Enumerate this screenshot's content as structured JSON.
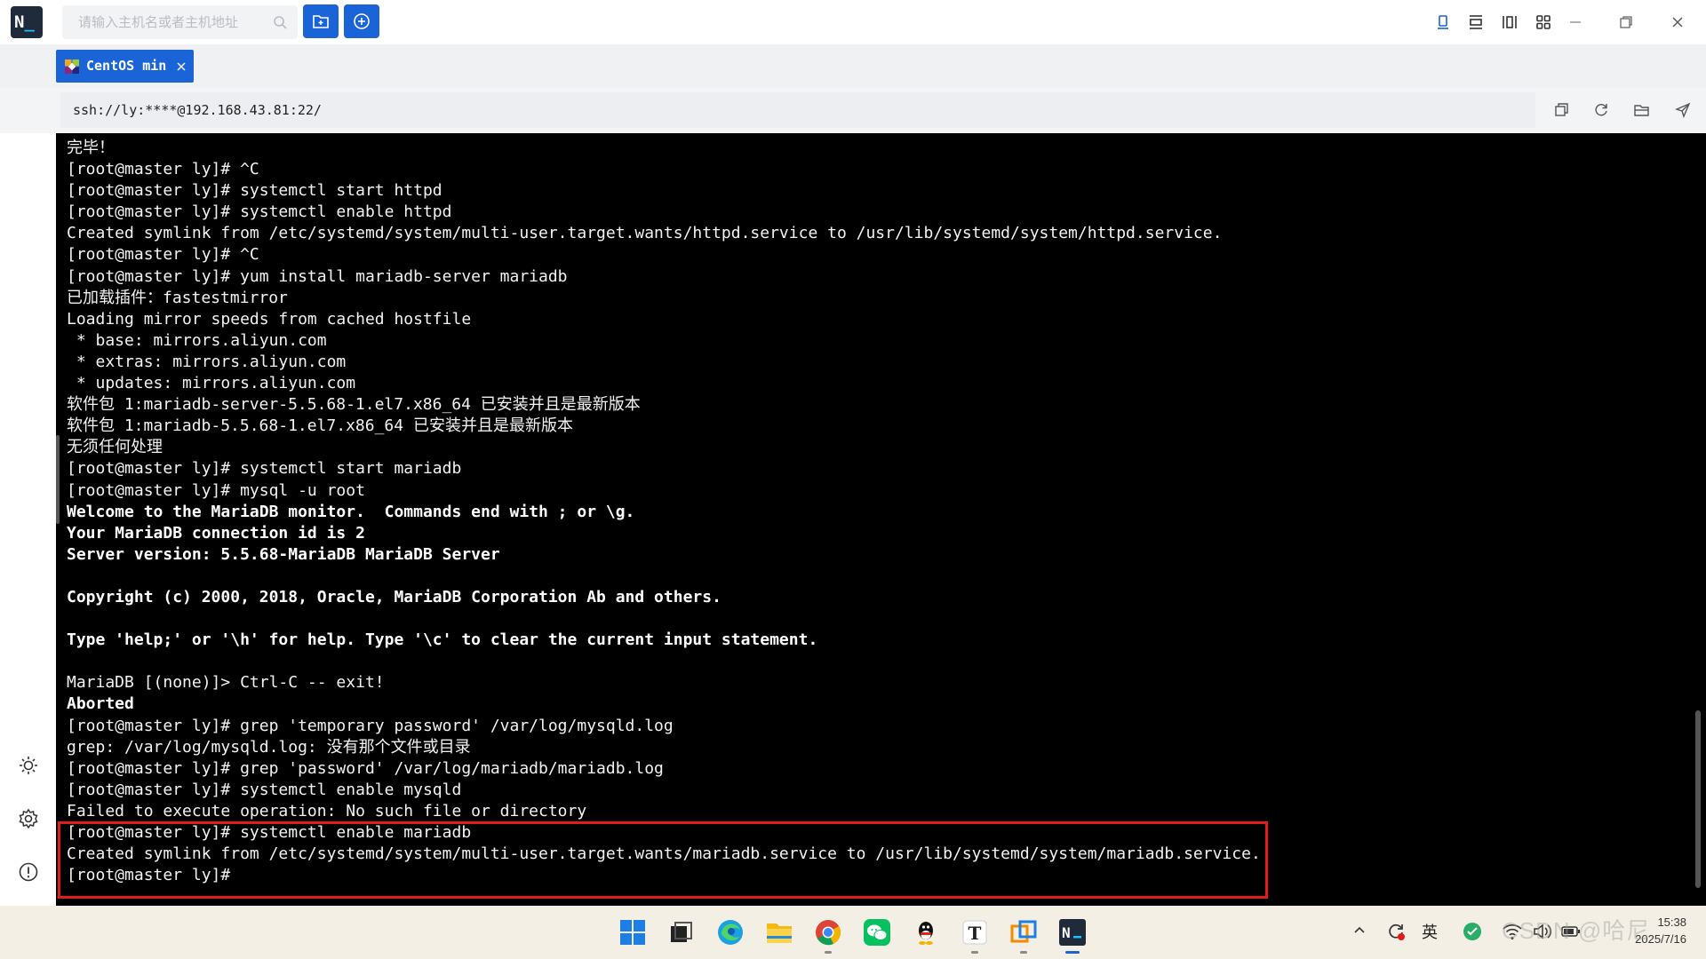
{
  "app": {
    "logo_n": "N",
    "logo_cursor": "_",
    "search_placeholder": "请输入主机名或者主机地址",
    "icons": {
      "search": "search-icon",
      "new_folder": "folder-add-icon",
      "new_connection": "plus-circle-icon",
      "view_single": "view-single-icon",
      "view_rows": "view-rows-icon",
      "view_columns": "view-columns-icon",
      "view_grid": "view-grid-icon",
      "minimize": "minimize-icon",
      "maximize": "restore-icon",
      "close": "close-icon"
    },
    "accent_color": "#1a64d8"
  },
  "tab": {
    "label": "CentOS min",
    "icon": "centos-icon",
    "close_icon": "close-icon"
  },
  "address": {
    "value": "ssh://ly:****@192.168.43.81:22/",
    "icons": [
      "copy-icon",
      "refresh-icon",
      "folder-open-icon",
      "send-icon"
    ]
  },
  "sidebar_icons": [
    "theme-sun-icon",
    "settings-gear-icon",
    "info-icon"
  ],
  "terminal": {
    "lines": [
      {
        "text": "完毕！",
        "bold": false
      },
      {
        "text": "[root@master ly]# ^C",
        "bold": false
      },
      {
        "text": "[root@master ly]# systemctl start httpd",
        "bold": false
      },
      {
        "text": "[root@master ly]# systemctl enable httpd",
        "bold": false
      },
      {
        "text": "Created symlink from /etc/systemd/system/multi-user.target.wants/httpd.service to /usr/lib/systemd/system/httpd.service.",
        "bold": false
      },
      {
        "text": "[root@master ly]# ^C",
        "bold": false
      },
      {
        "text": "[root@master ly]# yum install mariadb-server mariadb",
        "bold": false
      },
      {
        "text": "已加载插件：fastestmirror",
        "bold": false
      },
      {
        "text": "Loading mirror speeds from cached hostfile",
        "bold": false
      },
      {
        "text": " * base: mirrors.aliyun.com",
        "bold": false
      },
      {
        "text": " * extras: mirrors.aliyun.com",
        "bold": false
      },
      {
        "text": " * updates: mirrors.aliyun.com",
        "bold": false
      },
      {
        "text": "软件包 1:mariadb-server-5.5.68-1.el7.x86_64 已安装并且是最新版本",
        "bold": false
      },
      {
        "text": "软件包 1:mariadb-5.5.68-1.el7.x86_64 已安装并且是最新版本",
        "bold": false
      },
      {
        "text": "无须任何处理",
        "bold": false
      },
      {
        "text": "[root@master ly]# systemctl start mariadb",
        "bold": false
      },
      {
        "text": "[root@master ly]# mysql -u root",
        "bold": false
      },
      {
        "text": "Welcome to the MariaDB monitor.  Commands end with ; or \\g.",
        "bold": true
      },
      {
        "text": "Your MariaDB connection id is 2",
        "bold": true
      },
      {
        "text": "Server version: 5.5.68-MariaDB MariaDB Server",
        "bold": true
      },
      {
        "text": "",
        "bold": false
      },
      {
        "text": "Copyright (c) 2000, 2018, Oracle, MariaDB Corporation Ab and others.",
        "bold": true
      },
      {
        "text": "",
        "bold": false
      },
      {
        "text": "Type 'help;' or '\\h' for help. Type '\\c' to clear the current input statement.",
        "bold": true
      },
      {
        "text": "",
        "bold": false
      },
      {
        "text": "MariaDB [(none)]> Ctrl-C -- exit!",
        "bold": false
      },
      {
        "text": "Aborted",
        "bold": true
      },
      {
        "text": "[root@master ly]# grep 'temporary password' /var/log/mysqld.log",
        "bold": false
      },
      {
        "text": "grep: /var/log/mysqld.log: 没有那个文件或目录",
        "bold": false
      },
      {
        "text": "[root@master ly]# grep 'password' /var/log/mariadb/mariadb.log",
        "bold": false
      },
      {
        "text": "[root@master ly]# systemctl enable mysqld",
        "bold": false
      },
      {
        "text": "Failed to execute operation: No such file or directory",
        "bold": false
      },
      {
        "text": "[root@master ly]# systemctl enable mariadb",
        "bold": false
      },
      {
        "text": "Created symlink from /etc/systemd/system/multi-user.target.wants/mariadb.service to /usr/lib/systemd/system/mariadb.service.",
        "bold": false
      },
      {
        "text": "[root@master ly]# ",
        "bold": false
      }
    ],
    "highlight_color": "#e21b1b",
    "background": "#000000"
  },
  "taskbar": {
    "apps": [
      "windows-start-icon",
      "task-view-icon",
      "edge-icon",
      "file-explorer-icon",
      "chrome-icon",
      "wechat-icon",
      "qq-icon",
      "typora-icon",
      "vmware-icon",
      "terminal-app-icon"
    ],
    "tray_icons": [
      "chevron-up-icon",
      "sync-icon",
      "wifi-icon",
      "volume-icon",
      "battery-icon"
    ],
    "language": "英",
    "time": "15:38",
    "date": "2025/7/16",
    "watermark": "CSDN @哈尼"
  }
}
